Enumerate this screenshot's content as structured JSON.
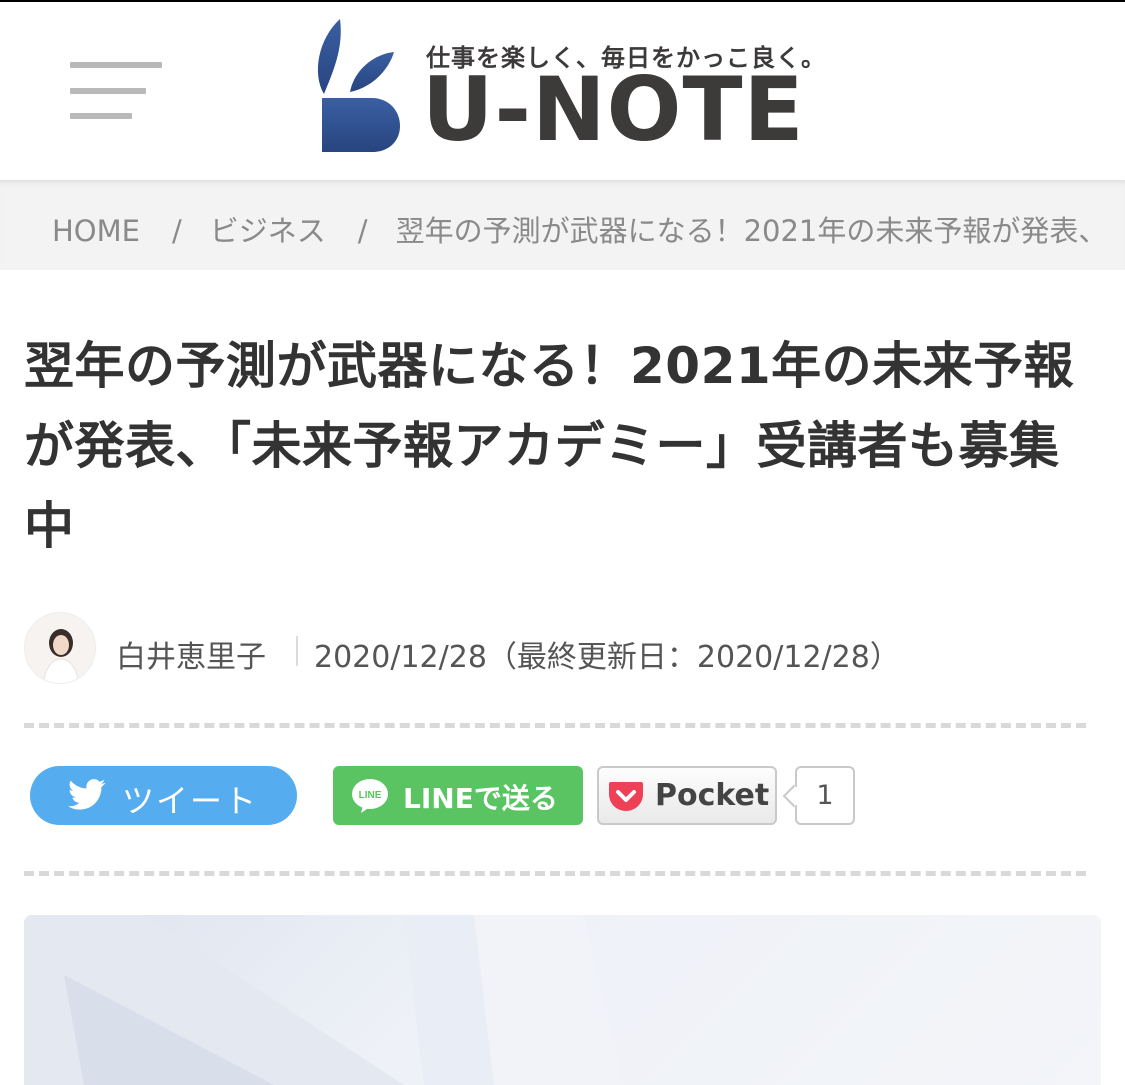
{
  "header": {
    "tagline": "仕事を楽しく、毎日をかっこ良く。",
    "wordmark": "U-NOTE",
    "brand_color": "#2f4f8f"
  },
  "breadcrumb": {
    "home": "HOME",
    "separator": "/",
    "category": "ビジネス",
    "current": "翌年の予測が武器になる！2021年の未来予報が発表、"
  },
  "article": {
    "title": "翌年の予測が武器になる！2021年の未来予報が発表、「未来予報アカデミー」受講者も募集中",
    "author": "白井恵里子",
    "date": "2020/12/28（最終更新日：2020/12/28）"
  },
  "share": {
    "tweet_label": "ツイート",
    "line_label": "LINEで送る",
    "pocket_label": "Pocket",
    "pocket_count": "1",
    "colors": {
      "twitter": "#55acee",
      "line": "#5ac463",
      "pocket": "#ee4056"
    }
  },
  "icons": {
    "menu": "hamburger-icon",
    "logo": "leaf-logo-icon",
    "twitter": "twitter-bird-icon",
    "line": "line-icon",
    "pocket": "pocket-icon"
  }
}
